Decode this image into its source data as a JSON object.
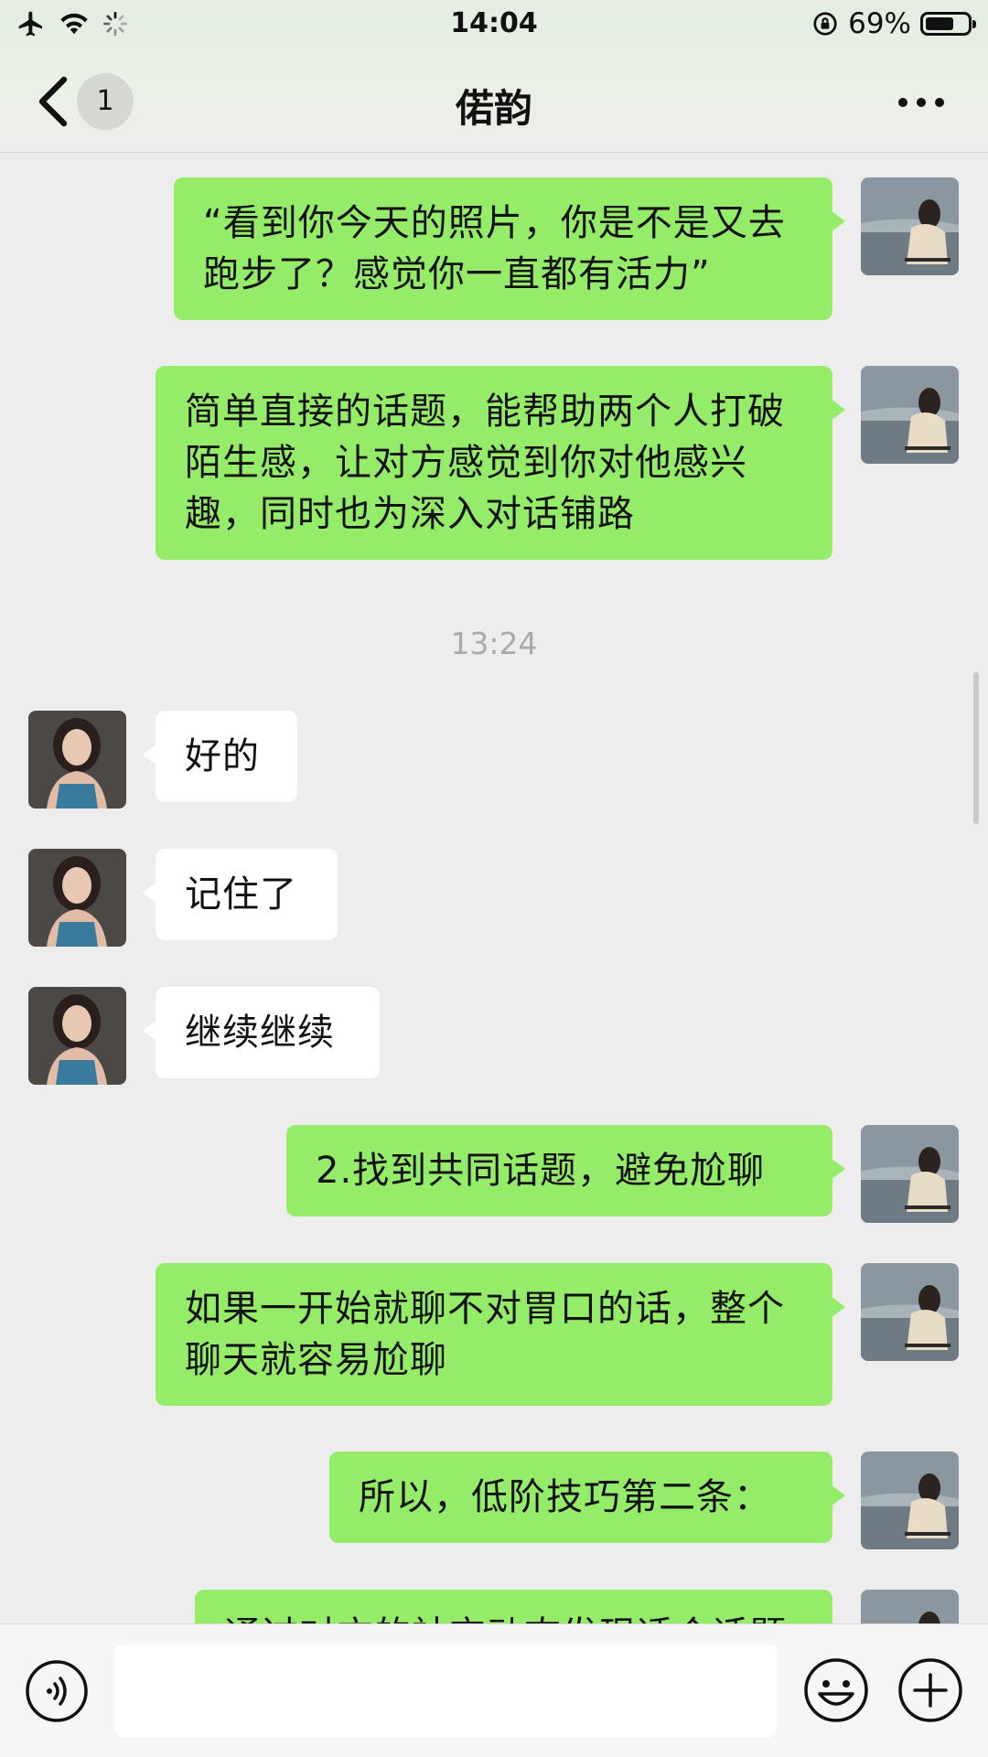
{
  "status_bar": {
    "time": "14:04",
    "battery_text": "69%",
    "battery_level": 0.69
  },
  "header": {
    "title": "偌韵",
    "unread_count": "1"
  },
  "messages": [
    {
      "sender": "me",
      "text": "“看到你今天的照片，你是不是又去跑步了？感觉你一直都有活力”"
    },
    {
      "sender": "me",
      "text": "简单直接的话题，能帮助两个人打破陌生感，让对方感觉到你对他感兴趣，同时也为深入对话铺路"
    },
    {
      "type": "timestamp",
      "text": "13:24"
    },
    {
      "sender": "her",
      "text": "好的"
    },
    {
      "sender": "her",
      "text": "记住了"
    },
    {
      "sender": "her",
      "text": "继续继续"
    },
    {
      "sender": "me",
      "text": "2.找到共同话题，避免尬聊"
    },
    {
      "sender": "me",
      "text": "如果一开始就聊不对胃口的话，整个聊天就容易尬聊"
    },
    {
      "sender": "me",
      "text": "所以，低阶技巧第二条："
    },
    {
      "sender": "me",
      "text": "通过对方的社交动态发现适合话题"
    }
  ],
  "input": {
    "value": "",
    "placeholder": ""
  }
}
